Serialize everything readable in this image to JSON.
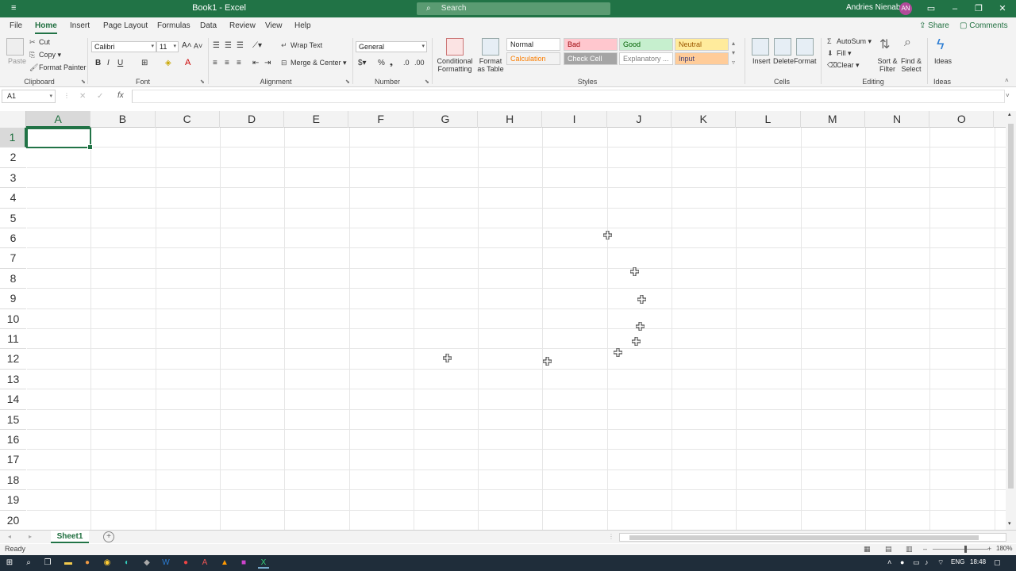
{
  "window": {
    "title": "Book1 - Excel",
    "search_placeholder": "Search",
    "user_name": "Andries Nienaber",
    "user_initials": "AN"
  },
  "tabs": [
    "File",
    "Home",
    "Insert",
    "Page Layout",
    "Formulas",
    "Data",
    "Review",
    "View",
    "Help"
  ],
  "active_tab": "Home",
  "share_label": "Share",
  "comments_label": "Comments",
  "ribbon": {
    "clipboard": {
      "paste": "Paste",
      "cut": "Cut",
      "copy": "Copy",
      "format_painter": "Format Painter",
      "label": "Clipboard"
    },
    "font": {
      "name": "Calibri",
      "size": "11",
      "label": "Font"
    },
    "alignment": {
      "wrap_text": "Wrap Text",
      "merge_center": "Merge & Center",
      "label": "Alignment"
    },
    "number": {
      "format": "General",
      "label": "Number"
    },
    "styles": {
      "conditional_formatting": "Conditional Formatting",
      "format_as_table": "Format as Table",
      "cells": [
        {
          "name": "Normal",
          "bg": "#ffffff",
          "fg": "#222222"
        },
        {
          "name": "Bad",
          "bg": "#ffc7ce",
          "fg": "#9c0006"
        },
        {
          "name": "Good",
          "bg": "#c6efce",
          "fg": "#006100"
        },
        {
          "name": "Neutral",
          "bg": "#ffeb9c",
          "fg": "#9c5700"
        },
        {
          "name": "Calculation",
          "bg": "#f2f2f2",
          "fg": "#fa7d00"
        },
        {
          "name": "Check Cell",
          "bg": "#a5a5a5",
          "fg": "#ffffff"
        },
        {
          "name": "Explanatory ...",
          "bg": "#ffffff",
          "fg": "#7f7f7f"
        },
        {
          "name": "Input",
          "bg": "#ffcc99",
          "fg": "#3f3f76"
        }
      ],
      "label": "Styles"
    },
    "cells_group": {
      "insert": "Insert",
      "delete": "Delete",
      "format": "Format",
      "label": "Cells"
    },
    "editing": {
      "autosum": "AutoSum",
      "fill": "Fill",
      "clear": "Clear",
      "sort_filter": "Sort & Filter",
      "find_select": "Find & Select",
      "label": "Editing"
    },
    "ideas": {
      "ideas": "Ideas",
      "label": "Ideas"
    }
  },
  "name_box": "A1",
  "formula_fx": "fx",
  "columns": [
    "A",
    "B",
    "C",
    "D",
    "E",
    "F",
    "G",
    "H",
    "I",
    "J",
    "K",
    "L",
    "M",
    "N",
    "O"
  ],
  "rows": [
    "1",
    "2",
    "3",
    "4",
    "5",
    "6",
    "7",
    "8",
    "9",
    "10",
    "11",
    "12",
    "13",
    "14",
    "15",
    "16",
    "17",
    "18",
    "19",
    "20"
  ],
  "selected_cell": "A1",
  "sheet_tabs": [
    "Sheet1"
  ],
  "status": {
    "ready": "Ready",
    "zoom": "180%"
  },
  "taskbar": {
    "lang": "ENG",
    "time": "18:48"
  },
  "colors": {
    "accent": "#217346"
  }
}
